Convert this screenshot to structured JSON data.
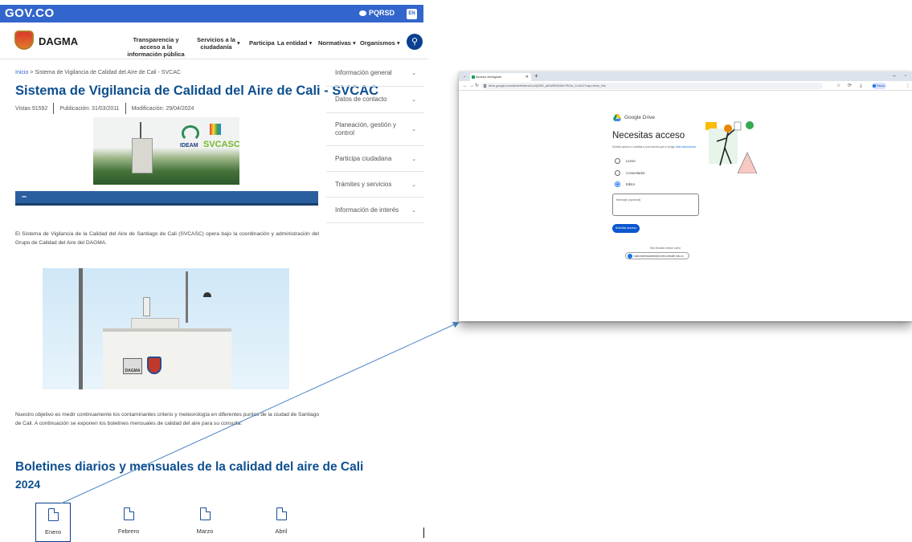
{
  "dagma_page": {
    "gov_logo": "GOV.CO",
    "pqrsd": "PQRSD",
    "lang": "EN",
    "site_name": "DAGMA",
    "nav": {
      "transparencia": "Transparencia y acceso a la información pública",
      "servicios": "Servicios a la ciudadanía",
      "participa": "Participa",
      "entidad": "La entidad",
      "normativas": "Normativas",
      "organismos": "Organismos"
    },
    "breadcrumb": {
      "home": "Inicio",
      "separator": ">",
      "current": "Sistema de Vigilancia de Calidad del Aire de Cali - SVCAC"
    },
    "title": "Sistema de Vigilancia de Calidad del Aire de Cali - SVCAC",
    "meta": {
      "views": "Vistas 91592",
      "published": "Publicación: 31/03/2011",
      "modified": "Modificación: 29/04/2024"
    },
    "hero_logos": {
      "ideam": "IDEAM",
      "svcasc": "SVCASC"
    },
    "accordion_symbol": "–",
    "intro_paragraph": "El Sistema de Vigilancia de la Calidad del Aire de Santiago de Cali (SVCASC) opera bajo la coordinación y administración del Grupo de Calidad del Aire del DAGMA.",
    "objective_paragraph": "Nuestro objetivo es medir continuamente los contaminantes criterio y meteorología en diferentes puntos de la ciudad de Santiago de Cali. A continuación se exponen los boletines mensuales de calidad del aire para su consulta:",
    "station_badge": "DAGMA",
    "section_title": "Boletines diarios y mensuales de la calidad del aire de Cali",
    "section_year": "2024",
    "bulletins": [
      {
        "label": "Enero"
      },
      {
        "label": "Febrero"
      },
      {
        "label": "Marzo"
      },
      {
        "label": "Abril"
      }
    ],
    "sidebar_menu": [
      {
        "label": "Información general"
      },
      {
        "label": "Datos de contacto"
      },
      {
        "label": "Planeación, gestión y control"
      },
      {
        "label": "Participa ciudadana"
      },
      {
        "label": "Trámites y servicios"
      },
      {
        "label": "Información de interés"
      }
    ]
  },
  "browser": {
    "tab_title": "Acceso denegado",
    "url": "drive.google.com/drive/folders/1cxXjV8G_pD0vRfZ5nEtr7EiJor_0-r4GJ?usp=drive_link",
    "profile_label": "Pausa",
    "drive": {
      "brand": "Google Drive",
      "title": "Necesitas acceso",
      "description": "Solicita acceso u cambia a una cuenta que lo tenga.",
      "more_info": "Más información",
      "roles": [
        {
          "label": "Lector",
          "checked": false
        },
        {
          "label": "Comentador",
          "checked": false
        },
        {
          "label": "Editor",
          "checked": true
        }
      ],
      "message_placeholder": "Mensaje (opcional)",
      "request_button": "Solicitar acceso",
      "session_label": "Has iniciado sesión como",
      "account_email": "tuanomeestudiante@correo.univalle.edu.co"
    }
  },
  "colors": {
    "gov_blue": "#3366cc",
    "title_blue": "#0e4f8f",
    "accordion_blue": "#2b5e9e",
    "google_blue": "#0b57d0",
    "arrow_blue": "#4a86c8"
  }
}
